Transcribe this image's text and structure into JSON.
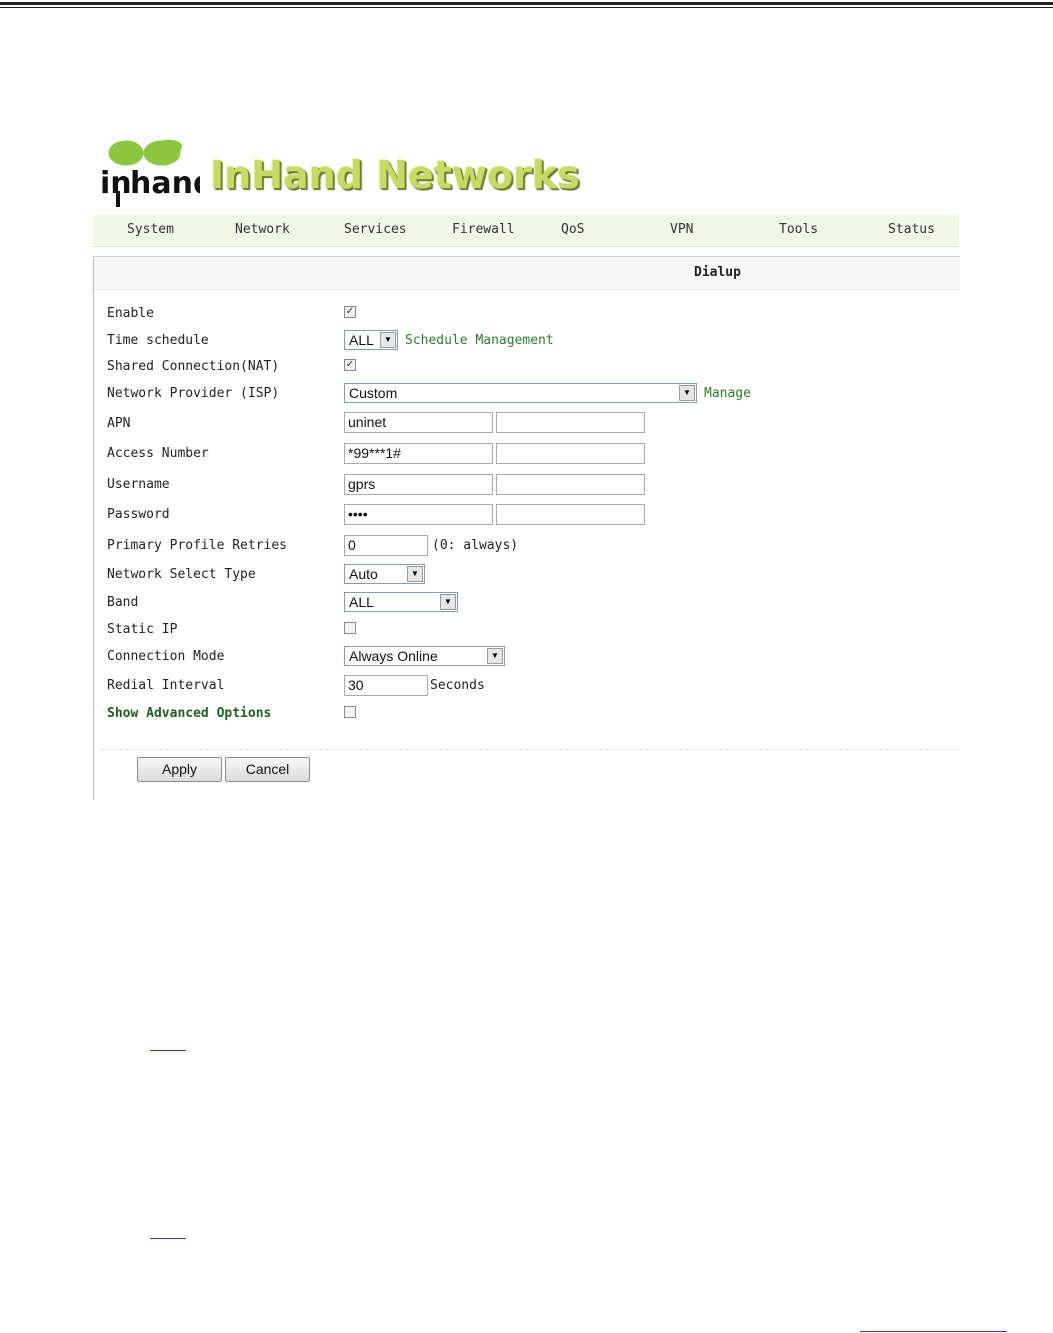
{
  "brand": {
    "logo_text": "inhand",
    "name": "InHand Networks"
  },
  "nav": [
    "System",
    "Network",
    "Services",
    "Firewall",
    "QoS",
    "VPN",
    "Tools",
    "Status"
  ],
  "panel_title": "Dialup",
  "labels": {
    "enable": "Enable",
    "time_schedule": "Time schedule",
    "shared_connection": "Shared Connection(NAT)",
    "network_provider": "Network Provider (ISP)",
    "apn": "APN",
    "access_number": "Access Number",
    "username": "Username",
    "password": "Password",
    "primary_profile_retries": "Primary Profile Retries",
    "network_select_type": "Network Select Type",
    "band": "Band",
    "static_ip": "Static IP",
    "connection_mode": "Connection Mode",
    "redial_interval": "Redial Interval",
    "show_advanced": "Show Advanced Options"
  },
  "values": {
    "enable": true,
    "time_schedule": "ALL",
    "shared_connection": true,
    "network_provider": "Custom",
    "apn": "uninet",
    "access_number": "*99***1#",
    "username": "gprs",
    "password": "••••",
    "primary_profile_retries": "0",
    "network_select_type": "Auto",
    "band": "ALL",
    "static_ip": false,
    "connection_mode": "Always Online",
    "redial_interval": "30",
    "show_advanced": false
  },
  "links": {
    "schedule_management": "Schedule Management",
    "manage": "Manage"
  },
  "notes": {
    "retries_hint": "(0: always)",
    "seconds": "Seconds"
  },
  "buttons": {
    "apply": "Apply",
    "cancel": "Cancel"
  }
}
